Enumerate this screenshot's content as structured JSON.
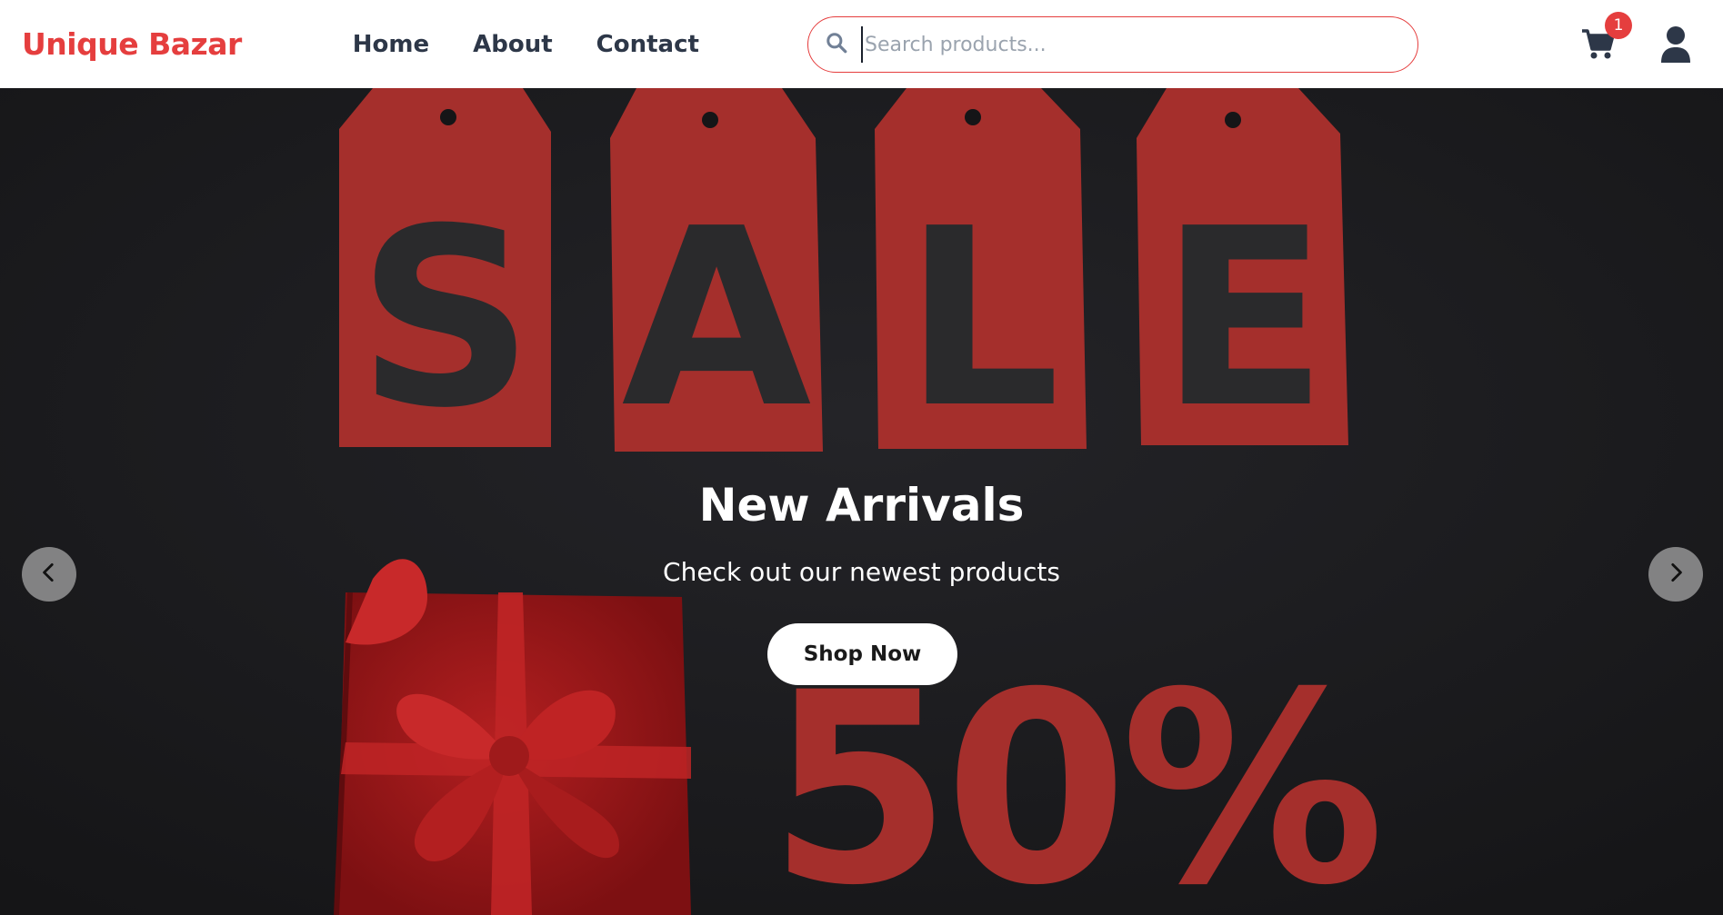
{
  "header": {
    "brand": "Unique Bazar",
    "nav": [
      {
        "label": "Home"
      },
      {
        "label": "About"
      },
      {
        "label": "Contact"
      }
    ],
    "search": {
      "placeholder": "Search products...",
      "value": ""
    },
    "cart_count": "1",
    "icons": {
      "search": "search-icon",
      "cart": "cart-icon",
      "user": "user-icon"
    }
  },
  "hero": {
    "title": "New Arrivals",
    "subtitle": "Check out our newest products",
    "cta": "Shop Now",
    "image_text": {
      "tags": [
        "S",
        "A",
        "L",
        "E"
      ],
      "discount": "50%"
    },
    "prev_icon": "chevron-left-icon",
    "next_icon": "chevron-right-icon"
  },
  "colors": {
    "brand": "#e53e3e",
    "nav_text": "#2d3748",
    "hero_background": "#1c1c1f",
    "tag_red": "#a52f2c",
    "tag_letter": "#2a2a2c"
  }
}
